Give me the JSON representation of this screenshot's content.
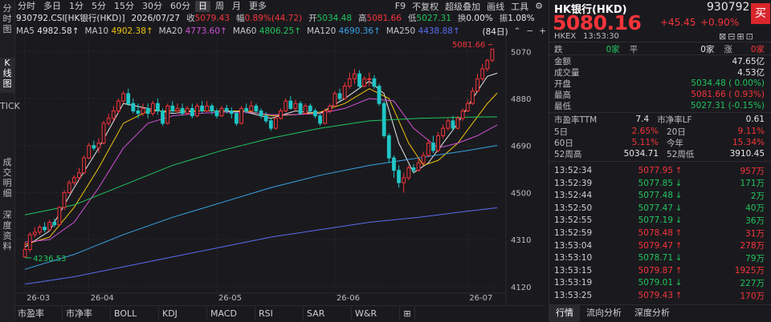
{
  "left_tabs": [
    {
      "label": "分时图",
      "active": false
    },
    {
      "label": "K线图",
      "active": true
    },
    {
      "label": "TICK",
      "active": false
    },
    {
      "label": "成交明细",
      "active": false
    },
    {
      "label": "深度资料",
      "active": false
    }
  ],
  "periods": [
    "分时",
    "多日",
    "1分",
    "5分",
    "15分",
    "30分",
    "60分",
    "日",
    "周",
    "月",
    "更多"
  ],
  "active_period": "日",
  "top_right_opts": [
    "F9",
    "不复权",
    "超级叠加",
    "画线",
    "工具"
  ],
  "info": {
    "code": "930792.CSI[HK银行(HKD)]",
    "date": "2026/07/27",
    "close_label": "收",
    "close": "5079.43",
    "chg_label": "幅",
    "chg": "0.89%(44.72)",
    "open_label": "开",
    "open": "5034.48",
    "high_label": "高",
    "high": "5081.66",
    "low_label": "低",
    "low": "5027.31",
    "turn_label": "换",
    "turn": "0.00%",
    "amp_label": "振",
    "amp": "1.08%"
  },
  "ma": [
    {
      "label": "MA5",
      "value": "4982.58↑",
      "color": "#e6e6e6"
    },
    {
      "label": "MA10",
      "value": "4902.38↑",
      "color": "#f1c40f"
    },
    {
      "label": "MA20",
      "value": "4773.60↑",
      "color": "#d052d8"
    },
    {
      "label": "MA60",
      "value": "4806.25↑",
      "color": "#22c55e"
    },
    {
      "label": "MA120",
      "value": "4690.36↑",
      "color": "#3aa3e8"
    },
    {
      "label": "MA250",
      "value": "4438.88↑",
      "color": "#5a6cf0"
    }
  ],
  "count_label": "(84日)",
  "chart_data": {
    "type": "candlestick",
    "ylim": [
      4100,
      5110
    ],
    "yticks": [
      5070,
      4880,
      4690,
      4500,
      4310,
      4120
    ],
    "xticks": [
      "26-03",
      "26-04",
      "26-05",
      "26-06",
      "26-07"
    ],
    "x_tick_index": [
      0,
      13,
      39,
      63,
      90
    ],
    "high_annotation": "5081.66",
    "low_annotation": "4236.53",
    "candles": [
      [
        4240,
        4270,
        4236.53,
        4300
      ],
      [
        4270,
        4330,
        4260,
        4340
      ],
      [
        4330,
        4340,
        4320,
        4360
      ],
      [
        4340,
        4360,
        4330,
        4370
      ],
      [
        4360,
        4350,
        4340,
        4380
      ],
      [
        4350,
        4380,
        4345,
        4390
      ],
      [
        4380,
        4370,
        4360,
        4395
      ],
      [
        4370,
        4440,
        4365,
        4445
      ],
      [
        4440,
        4500,
        4430,
        4510
      ],
      [
        4500,
        4540,
        4495,
        4550
      ],
      [
        4540,
        4560,
        4530,
        4570
      ],
      [
        4560,
        4580,
        4550,
        4600
      ],
      [
        4580,
        4640,
        4575,
        4650
      ],
      [
        4640,
        4690,
        4635,
        4700
      ],
      [
        4690,
        4680,
        4670,
        4710
      ],
      [
        4680,
        4700,
        4660,
        4720
      ],
      [
        4700,
        4780,
        4695,
        4790
      ],
      [
        4780,
        4800,
        4770,
        4820
      ],
      [
        4800,
        4830,
        4790,
        4850
      ],
      [
        4830,
        4870,
        4820,
        4880
      ],
      [
        4870,
        4900,
        4860,
        4910
      ],
      [
        4900,
        4860,
        4850,
        4920
      ],
      [
        4860,
        4830,
        4820,
        4880
      ],
      [
        4830,
        4820,
        4800,
        4860
      ],
      [
        4820,
        4840,
        4810,
        4860
      ],
      [
        4840,
        4820,
        4800,
        4860
      ],
      [
        4820,
        4860,
        4810,
        4870
      ],
      [
        4860,
        4830,
        4815,
        4880
      ],
      [
        4830,
        4780,
        4770,
        4840
      ],
      [
        4780,
        4850,
        4775,
        4860
      ],
      [
        4850,
        4830,
        4820,
        4870
      ],
      [
        4830,
        4840,
        4820,
        4860
      ],
      [
        4840,
        4820,
        4810,
        4860
      ],
      [
        4820,
        4840,
        4815,
        4850
      ],
      [
        4840,
        4810,
        4800,
        4860
      ],
      [
        4810,
        4850,
        4805,
        4860
      ],
      [
        4850,
        4830,
        4820,
        4870
      ],
      [
        4830,
        4850,
        4825,
        4870
      ],
      [
        4850,
        4830,
        4815,
        4860
      ],
      [
        4830,
        4810,
        4800,
        4840
      ],
      [
        4810,
        4840,
        4805,
        4850
      ],
      [
        4840,
        4830,
        4820,
        4855
      ],
      [
        4830,
        4820,
        4800,
        4845
      ],
      [
        4820,
        4780,
        4770,
        4830
      ],
      [
        4780,
        4840,
        4775,
        4850
      ],
      [
        4840,
        4830,
        4820,
        4860
      ],
      [
        4830,
        4850,
        4825,
        4870
      ],
      [
        4850,
        4830,
        4820,
        4860
      ],
      [
        4830,
        4810,
        4800,
        4840
      ],
      [
        4810,
        4790,
        4780,
        4825
      ],
      [
        4790,
        4760,
        4750,
        4800
      ],
      [
        4760,
        4800,
        4755,
        4810
      ],
      [
        4800,
        4830,
        4795,
        4840
      ],
      [
        4830,
        4870,
        4825,
        4880
      ],
      [
        4870,
        4840,
        4835,
        4890
      ],
      [
        4840,
        4860,
        4830,
        4875
      ],
      [
        4860,
        4820,
        4815,
        4870
      ],
      [
        4820,
        4850,
        4815,
        4860
      ],
      [
        4850,
        4830,
        4820,
        4860
      ],
      [
        4830,
        4810,
        4800,
        4840
      ],
      [
        4810,
        4780,
        4770,
        4820
      ],
      [
        4780,
        4830,
        4775,
        4840
      ],
      [
        4830,
        4850,
        4820,
        4860
      ],
      [
        4850,
        4900,
        4845,
        4910
      ],
      [
        4900,
        4880,
        4870,
        4920
      ],
      [
        4880,
        4930,
        4875,
        4945
      ],
      [
        4930,
        4960,
        4920,
        4985
      ],
      [
        4960,
        4980,
        4940,
        5000
      ],
      [
        4980,
        4930,
        4920,
        4995
      ],
      [
        4930,
        4960,
        4925,
        4970
      ],
      [
        4960,
        4960,
        4930,
        4985
      ],
      [
        4960,
        4930,
        4920,
        4975
      ],
      [
        4930,
        4860,
        4850,
        4940
      ],
      [
        4860,
        4730,
        4720,
        4870
      ],
      [
        4730,
        4640,
        4620,
        4740
      ],
      [
        4640,
        4590,
        4560,
        4650
      ],
      [
        4590,
        4540,
        4520,
        4610
      ],
      [
        4540,
        4560,
        4500,
        4580
      ],
      [
        4560,
        4600,
        4550,
        4610
      ],
      [
        4600,
        4590,
        4580,
        4615
      ],
      [
        4590,
        4620,
        4585,
        4640
      ],
      [
        4620,
        4650,
        4610,
        4665
      ],
      [
        4650,
        4700,
        4645,
        4715
      ],
      [
        4700,
        4670,
        4660,
        4730
      ],
      [
        4670,
        4730,
        4665,
        4745
      ],
      [
        4730,
        4760,
        4720,
        4775
      ],
      [
        4760,
        4790,
        4750,
        4800
      ],
      [
        4790,
        4760,
        4755,
        4810
      ],
      [
        4760,
        4800,
        4755,
        4810
      ],
      [
        4800,
        4830,
        4790,
        4840
      ],
      [
        4830,
        4860,
        4825,
        4875
      ],
      [
        4860,
        4910,
        4855,
        4925
      ],
      [
        4910,
        4960,
        4905,
        4980
      ],
      [
        4960,
        5000,
        4950,
        5020
      ],
      [
        5000,
        5034.48,
        4990,
        5040
      ],
      [
        5034.48,
        5079.43,
        5027.31,
        5081.66
      ]
    ],
    "ma_lines": {
      "MA5": [
        [
          0,
          4280
        ],
        [
          5,
          4345
        ],
        [
          10,
          4520
        ],
        [
          15,
          4680
        ],
        [
          20,
          4860
        ],
        [
          25,
          4840
        ],
        [
          30,
          4820
        ],
        [
          35,
          4830
        ],
        [
          40,
          4830
        ],
        [
          45,
          4825
        ],
        [
          50,
          4800
        ],
        [
          55,
          4830
        ],
        [
          60,
          4820
        ],
        [
          65,
          4880
        ],
        [
          70,
          4950
        ],
        [
          73,
          4900
        ],
        [
          76,
          4700
        ],
        [
          79,
          4580
        ],
        [
          82,
          4620
        ],
        [
          85,
          4700
        ],
        [
          88,
          4780
        ],
        [
          91,
          4880
        ],
        [
          94,
          4970
        ],
        [
          96,
          4982.58
        ]
      ],
      "MA10": [
        [
          0,
          4290
        ],
        [
          5,
          4320
        ],
        [
          10,
          4440
        ],
        [
          15,
          4600
        ],
        [
          20,
          4780
        ],
        [
          25,
          4830
        ],
        [
          30,
          4830
        ],
        [
          35,
          4830
        ],
        [
          40,
          4830
        ],
        [
          45,
          4830
        ],
        [
          50,
          4810
        ],
        [
          55,
          4815
        ],
        [
          60,
          4825
        ],
        [
          65,
          4860
        ],
        [
          70,
          4920
        ],
        [
          74,
          4880
        ],
        [
          78,
          4700
        ],
        [
          81,
          4610
        ],
        [
          84,
          4630
        ],
        [
          88,
          4700
        ],
        [
          91,
          4780
        ],
        [
          94,
          4860
        ],
        [
          96,
          4902.38
        ]
      ],
      "MA20": [
        [
          0,
          4300
        ],
        [
          5,
          4310
        ],
        [
          10,
          4380
        ],
        [
          15,
          4520
        ],
        [
          20,
          4680
        ],
        [
          25,
          4780
        ],
        [
          30,
          4810
        ],
        [
          35,
          4820
        ],
        [
          40,
          4825
        ],
        [
          45,
          4825
        ],
        [
          50,
          4815
        ],
        [
          55,
          4815
        ],
        [
          60,
          4820
        ],
        [
          65,
          4840
        ],
        [
          70,
          4880
        ],
        [
          75,
          4870
        ],
        [
          79,
          4760
        ],
        [
          84,
          4680
        ],
        [
          88,
          4700
        ],
        [
          92,
          4730
        ],
        [
          96,
          4773.6
        ]
      ],
      "MA60": [
        [
          0,
          4410
        ],
        [
          10,
          4450
        ],
        [
          20,
          4530
        ],
        [
          30,
          4610
        ],
        [
          40,
          4670
        ],
        [
          50,
          4720
        ],
        [
          60,
          4760
        ],
        [
          70,
          4790
        ],
        [
          80,
          4800
        ],
        [
          90,
          4805
        ],
        [
          96,
          4806.25
        ]
      ],
      "MA120": [
        [
          0,
          4190
        ],
        [
          10,
          4250
        ],
        [
          20,
          4330
        ],
        [
          30,
          4400
        ],
        [
          40,
          4460
        ],
        [
          50,
          4520
        ],
        [
          60,
          4570
        ],
        [
          70,
          4610
        ],
        [
          80,
          4640
        ],
        [
          90,
          4670
        ],
        [
          96,
          4690.36
        ]
      ],
      "MA250": [
        [
          0,
          4130
        ],
        [
          10,
          4160
        ],
        [
          20,
          4200
        ],
        [
          30,
          4240
        ],
        [
          40,
          4280
        ],
        [
          50,
          4320
        ],
        [
          60,
          4350
        ],
        [
          70,
          4380
        ],
        [
          80,
          4400
        ],
        [
          90,
          4425
        ],
        [
          96,
          4438.88
        ]
      ]
    }
  },
  "bottom_tabs": [
    "市盈率",
    "市净率",
    "BOLL",
    "KDJ",
    "MACD",
    "RSI",
    "SAR",
    "W&R"
  ],
  "right": {
    "name": "HK银行(HKD)",
    "code": "930792",
    "price": "5080.16",
    "change": "+45.45",
    "change_pct": "+0.90%",
    "exchange": "HKEX",
    "time": "13:53:30",
    "buy_label": "买",
    "bidask": [
      {
        "label": "跌",
        "val": "0家"
      },
      {
        "label": "平",
        "val": "0家"
      },
      {
        "label": "涨",
        "val": "0家"
      }
    ],
    "stats": [
      {
        "label": "金额",
        "value": "47.65亿",
        "color": "#e6e6e6"
      },
      {
        "label": "成交量",
        "value": "4.53亿",
        "color": "#e6e6e6"
      },
      {
        "label": "开盘",
        "value": "5034.48 ( 0.00%)",
        "color": "#21c55e"
      },
      {
        "label": "最高",
        "value": "5081.66 ( 0.93%)",
        "color": "#f5343a"
      },
      {
        "label": "最低",
        "value": "5027.31 (-0.15%)",
        "color": "#21c55e"
      }
    ],
    "pe_label": "市盈率TTM",
    "pe": "7.4",
    "pb_label": "市净率LF",
    "pb": "0.61",
    "perf": [
      {
        "l1": "5日",
        "v1": "2.65%",
        "l2": "20日",
        "v2": "9.11%"
      },
      {
        "l1": "60日",
        "v1": "5.11%",
        "l2": "今年",
        "v2": "15.34%"
      }
    ],
    "w52": {
      "hi_label": "52周高",
      "hi": "5034.71",
      "lo_label": "52周低",
      "lo": "3910.45"
    },
    "ticks": [
      {
        "t": "13:52:34",
        "p": "5077.95",
        "d": "up",
        "v": "957万"
      },
      {
        "t": "13:52:39",
        "p": "5077.85",
        "d": "down",
        "v": "171万"
      },
      {
        "t": "13:52:44",
        "p": "5077.48",
        "d": "down",
        "v": "2万"
      },
      {
        "t": "13:52:50",
        "p": "5077.47",
        "d": "down",
        "v": "40万"
      },
      {
        "t": "13:52:55",
        "p": "5077.19",
        "d": "down",
        "v": "36万"
      },
      {
        "t": "13:52:59",
        "p": "5078.48",
        "d": "up",
        "v": "31万"
      },
      {
        "t": "13:53:04",
        "p": "5079.47",
        "d": "up",
        "v": "278万"
      },
      {
        "t": "13:53:10",
        "p": "5078.71",
        "d": "down",
        "v": "79万"
      },
      {
        "t": "13:53:15",
        "p": "5079.87",
        "d": "up",
        "v": "1925万"
      },
      {
        "t": "13:53:19",
        "p": "5079.01",
        "d": "down",
        "v": "227万"
      },
      {
        "t": "13:53:25",
        "p": "5079.43",
        "d": "up",
        "v": "170万"
      }
    ],
    "bottom_tabs": [
      "行情",
      "流向分析",
      "深度分析"
    ]
  }
}
